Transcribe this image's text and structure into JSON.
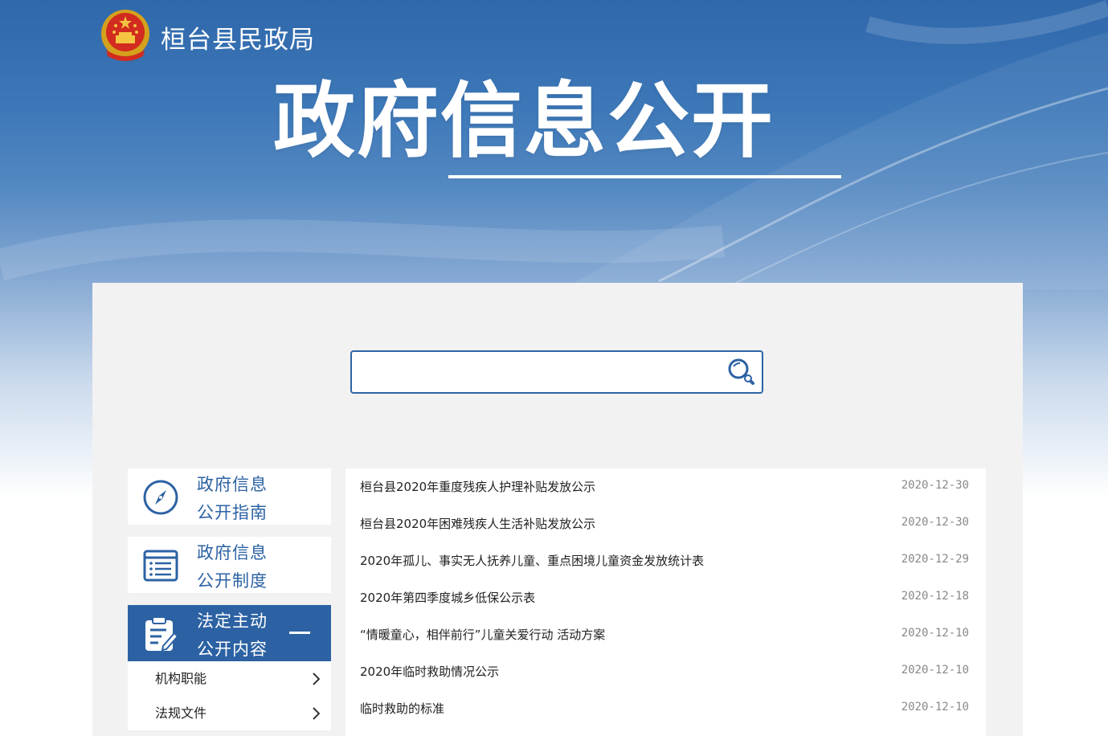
{
  "header": {
    "site_name": "桓台县民政局",
    "hero_title": "政府信息公开",
    "emblem_icon": "national-emblem-icon"
  },
  "search": {
    "placeholder": "",
    "value": "",
    "icon": "search-icon"
  },
  "sidebar": {
    "cards": [
      {
        "line1": "政府信息",
        "line2": "公开指南",
        "icon": "compass-icon",
        "active": false
      },
      {
        "line1": "政府信息",
        "line2": "公开制度",
        "icon": "list-document-icon",
        "active": false
      },
      {
        "line1": "法定主动",
        "line2": "公开内容",
        "icon": "clipboard-edit-icon",
        "active": true
      }
    ],
    "sub_items": [
      {
        "label": "机构职能"
      },
      {
        "label": "法规文件"
      }
    ]
  },
  "news": [
    {
      "title": "桓台县2020年重度残疾人护理补贴发放公示",
      "date": "2020-12-30"
    },
    {
      "title": "桓台县2020年困难残疾人生活补贴发放公示",
      "date": "2020-12-30"
    },
    {
      "title": "2020年孤儿、事实无人抚养儿童、重点困境儿童资金发放统计表",
      "date": "2020-12-29"
    },
    {
      "title": "2020年第四季度城乡低保公示表",
      "date": "2020-12-18"
    },
    {
      "title": "“情暖童心，相伴前行”儿童关爱行动 活动方案",
      "date": "2020-12-10"
    },
    {
      "title": "2020年临时救助情况公示",
      "date": "2020-12-10"
    },
    {
      "title": "临时救助的标准",
      "date": "2020-12-10"
    }
  ],
  "colors": {
    "brand_blue": "#2c62a3",
    "panel_bg": "#f2f2f2",
    "date_gray": "#888888"
  }
}
